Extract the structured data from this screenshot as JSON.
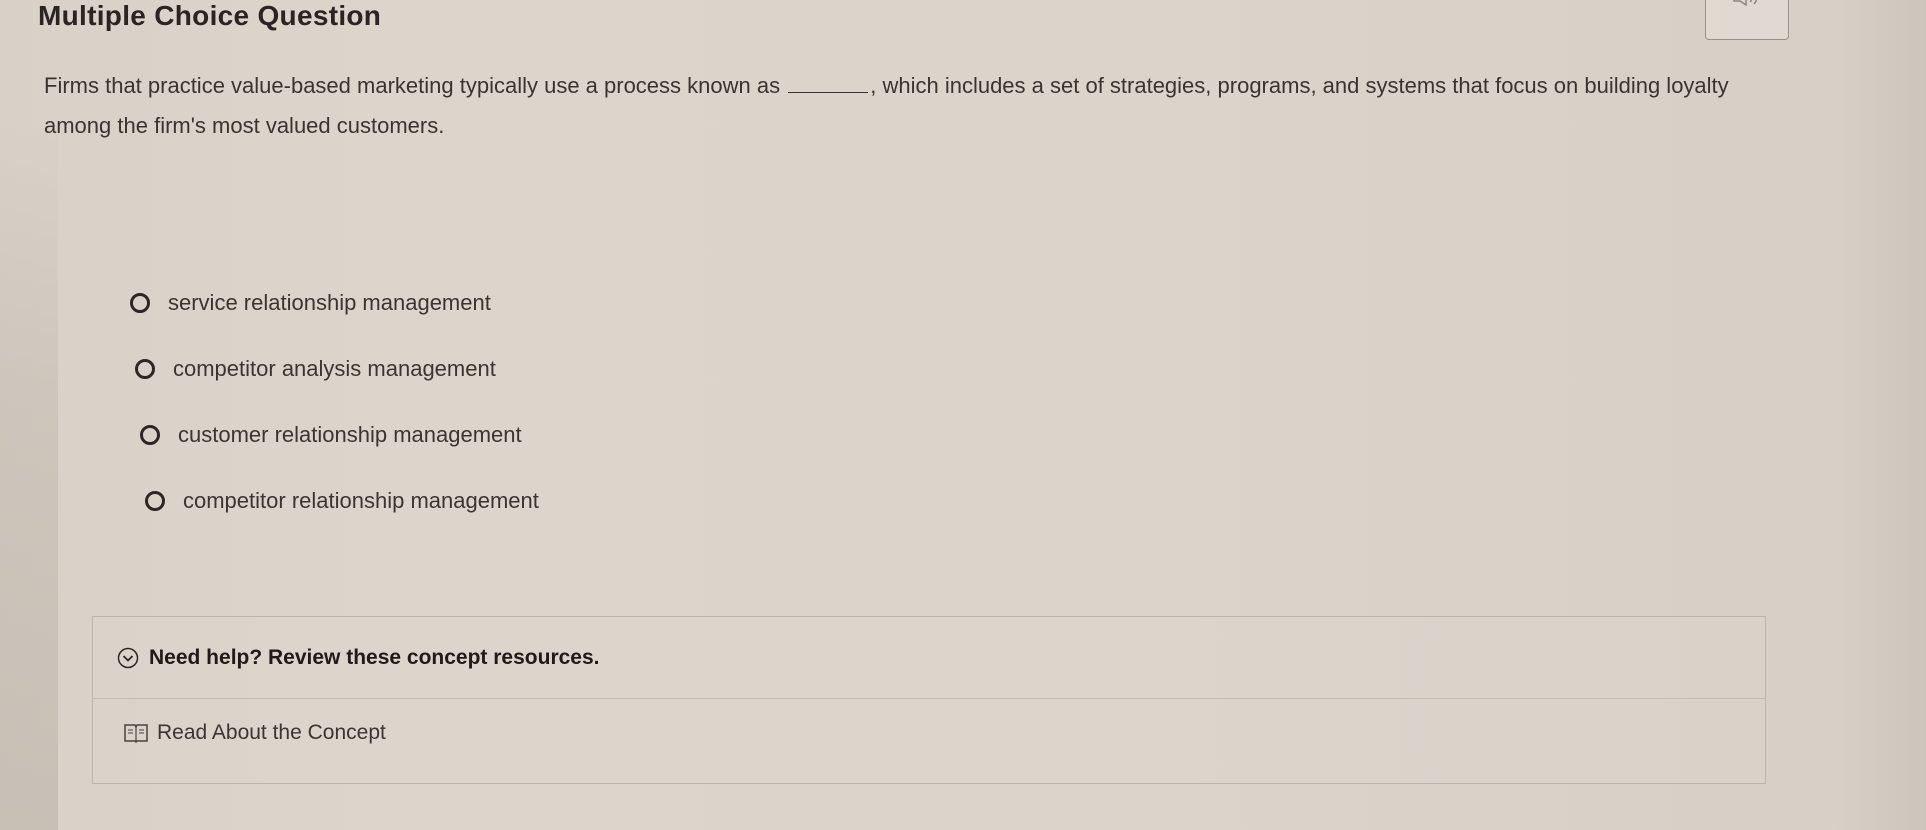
{
  "question": {
    "title": "Multiple Choice Question",
    "text_before": "Firms that practice value-based marketing typically use a process known as",
    "text_after": ", which includes a set of strategies, programs, and systems that focus on building loyalty among the firm's most valued customers."
  },
  "audio": {
    "icon": "speaker-icon"
  },
  "choices": [
    {
      "label": "service relationship management"
    },
    {
      "label": "competitor analysis management"
    },
    {
      "label": "customer relationship management"
    },
    {
      "label": "competitor relationship management"
    }
  ],
  "help": {
    "title": "Need help? Review these concept resources.",
    "icon": "chevron-down-circle-icon",
    "link_label": "Read About the Concept",
    "link_icon": "book-icon"
  }
}
